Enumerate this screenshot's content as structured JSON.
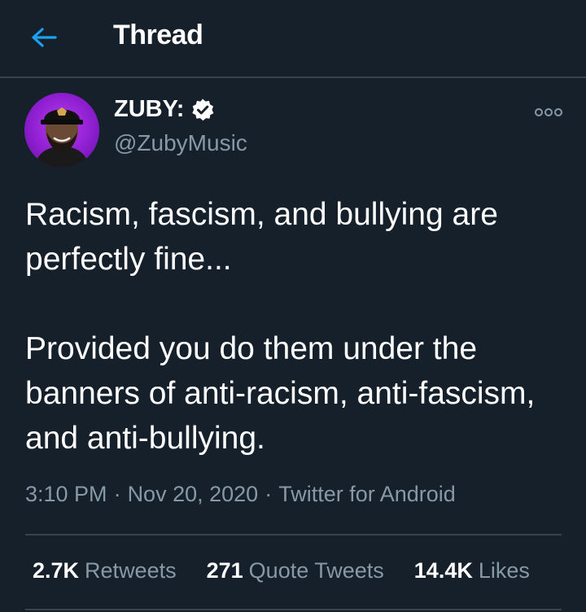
{
  "header": {
    "title": "Thread",
    "back_icon": "arrow-left-icon",
    "accent_color": "#1da1f2"
  },
  "tweet": {
    "author": {
      "name": "ZUBY:",
      "handle": "@ZubyMusic",
      "verified": true,
      "avatar_icon": "avatar"
    },
    "more_icon": "more-options-icon",
    "text_paragraphs": [
      "Racism, fascism, and bullying are perfectly fine...",
      "Provided you do them under the banners of anti-racism, anti-fascism, and anti-bullying."
    ],
    "time": "3:10 PM",
    "separator": "·",
    "date": "Nov 20, 2020",
    "source": "Twitter for Android"
  },
  "stats": {
    "retweets": {
      "count": "2.7K",
      "label": "Retweets"
    },
    "quote_tweets": {
      "count": "271",
      "label": "Quote Tweets"
    },
    "likes": {
      "count": "14.4K",
      "label": "Likes"
    }
  },
  "colors": {
    "background": "#15202b",
    "divider": "#38444d",
    "secondary_text": "#8899a6",
    "primary_text": "#ffffff",
    "accent": "#1da1f2"
  }
}
